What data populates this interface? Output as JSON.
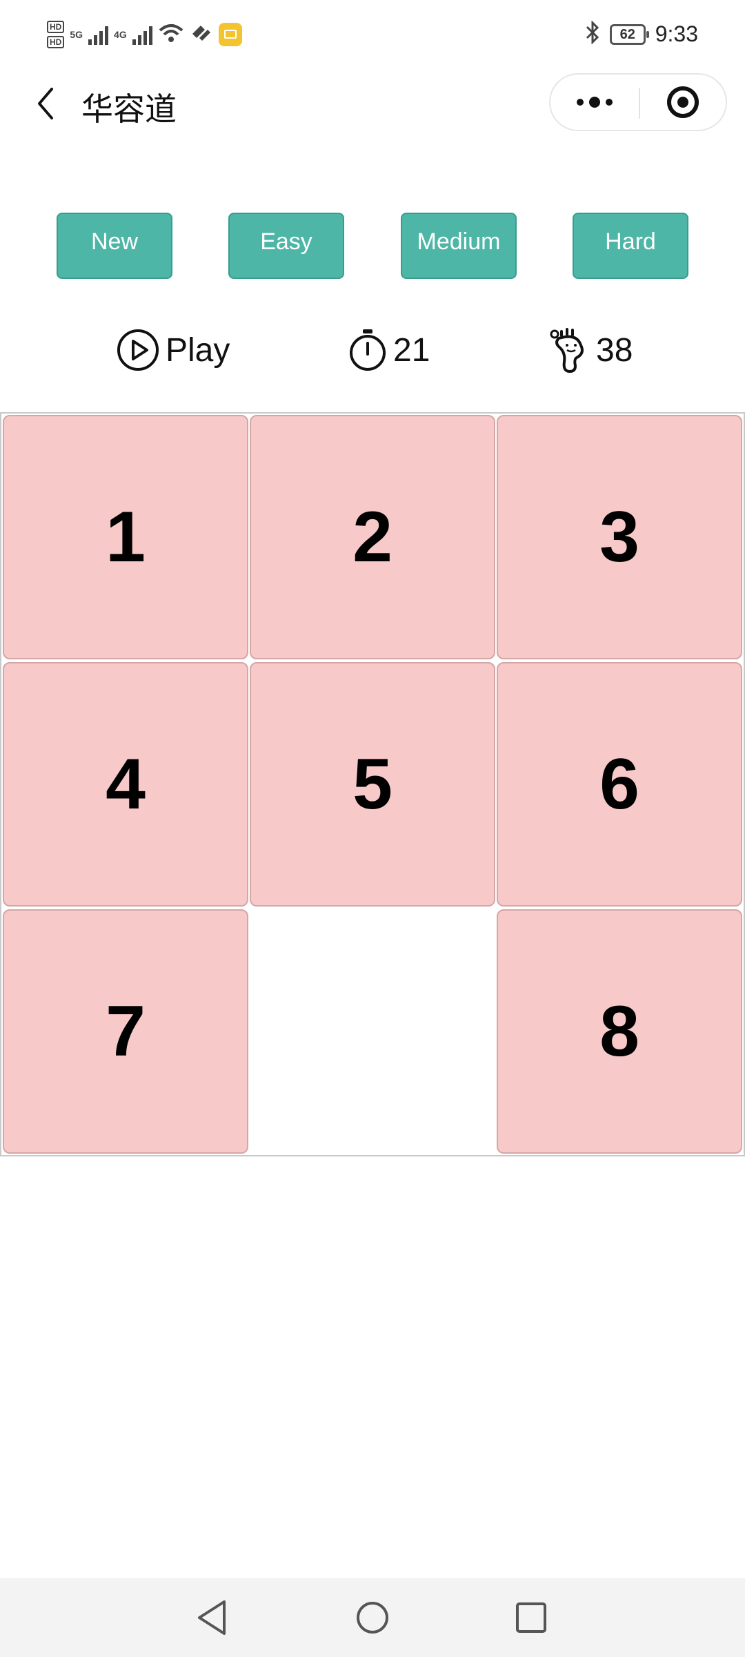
{
  "status_bar": {
    "hd_labels": [
      "HD",
      "HD"
    ],
    "network_1": "5G",
    "network_2": "4G",
    "battery_level": "62",
    "time": "9:33",
    "icons": [
      "signal-icon",
      "wifi-icon",
      "heart-icon",
      "mail-icon",
      "bluetooth-icon",
      "battery-icon"
    ]
  },
  "title_bar": {
    "title": "华容道",
    "icons": [
      "back-icon",
      "more-icon",
      "close-target-icon"
    ]
  },
  "buttons": [
    {
      "label": "New"
    },
    {
      "label": "Easy"
    },
    {
      "label": "Medium"
    },
    {
      "label": "Hard"
    }
  ],
  "info": {
    "play_label": "Play",
    "timer_value": "21",
    "steps_value": "38",
    "icons": [
      "play-icon",
      "stopwatch-icon",
      "footprint-icon"
    ]
  },
  "board": {
    "rows": 3,
    "cols": 3,
    "tiles": [
      "1",
      "2",
      "3",
      "4",
      "5",
      "6",
      "7",
      "",
      "8"
    ],
    "tile_color": "#f8c9c9"
  },
  "colors": {
    "button_accent": "#4db6a6",
    "tile": "#f8c9c9"
  },
  "nav_bar": {
    "icons": [
      "nav-back-icon",
      "nav-home-icon",
      "nav-recents-icon"
    ]
  }
}
